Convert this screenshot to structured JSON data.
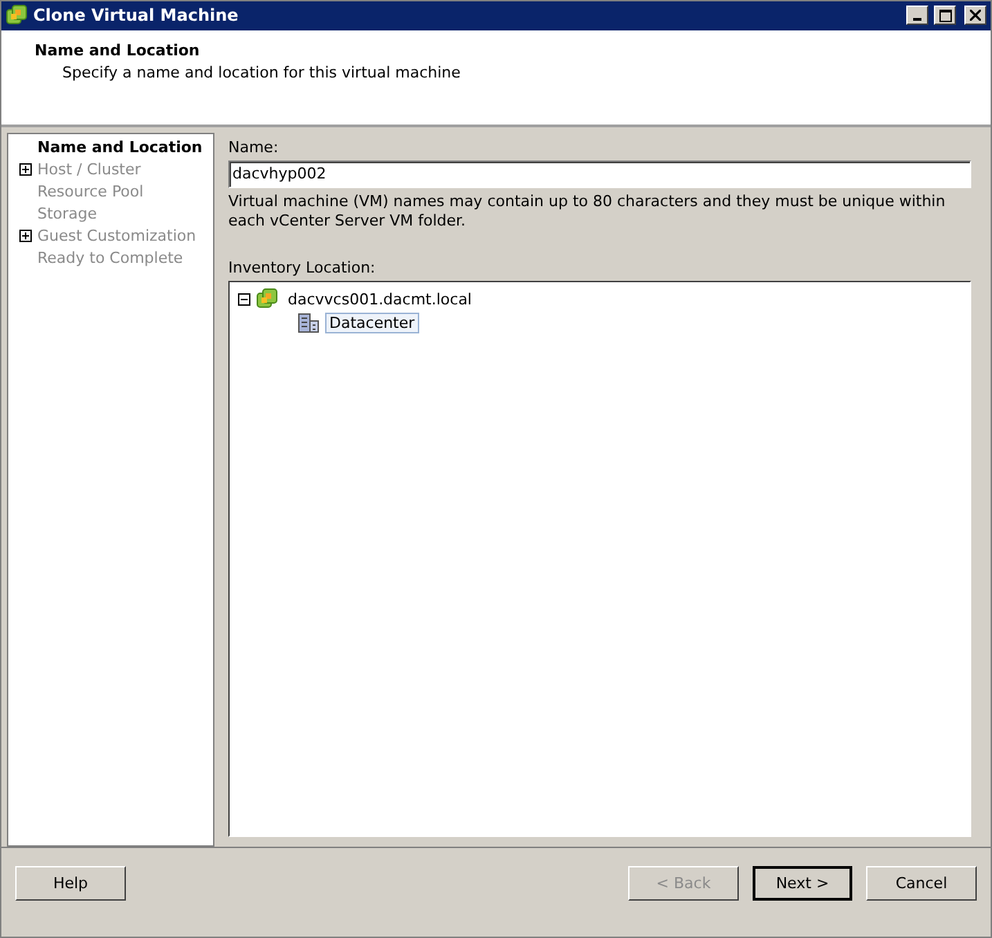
{
  "window": {
    "title": "Clone Virtual Machine"
  },
  "header": {
    "title": "Name and Location",
    "subtitle": "Specify a name and location for this virtual machine"
  },
  "steps": [
    {
      "label": "Name and Location",
      "selected": true,
      "expandable": false
    },
    {
      "label": "Host / Cluster",
      "selected": false,
      "expandable": true
    },
    {
      "label": "Resource Pool",
      "selected": false,
      "expandable": false
    },
    {
      "label": "Storage",
      "selected": false,
      "expandable": false
    },
    {
      "label": "Guest Customization",
      "selected": false,
      "expandable": true
    },
    {
      "label": "Ready to Complete",
      "selected": false,
      "expandable": false
    }
  ],
  "name_field": {
    "label": "Name:",
    "value": "dacvhyp002",
    "hint": "Virtual machine (VM) names may contain up to 80 characters and they must be unique within each vCenter Server VM folder."
  },
  "inventory": {
    "label": "Inventory Location:",
    "tree": [
      {
        "label": "dacvvcs001.dacmt.local",
        "kind": "vcenter",
        "expanded": true,
        "selected": false,
        "children": [
          {
            "label": "Datacenter",
            "kind": "datacenter",
            "selected": true
          }
        ]
      }
    ]
  },
  "buttons": [
    {
      "label": "Help",
      "disabled": false,
      "default": false
    },
    {
      "label": "< Back",
      "disabled": true,
      "default": false
    },
    {
      "label": "Next >",
      "disabled": false,
      "default": true
    },
    {
      "label": "Cancel",
      "disabled": false,
      "default": false
    }
  ]
}
